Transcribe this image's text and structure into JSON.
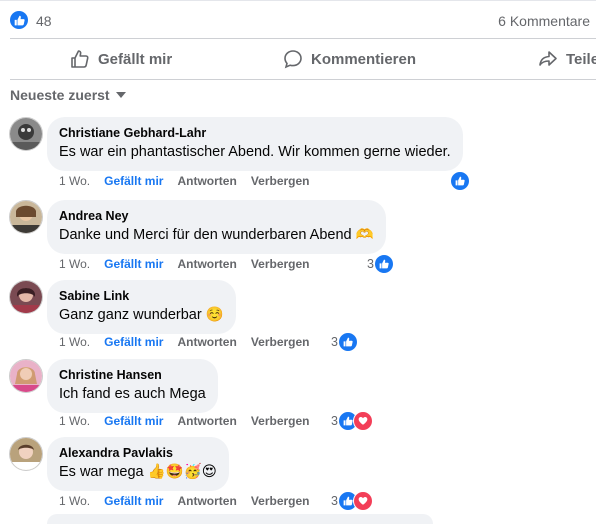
{
  "summary": {
    "like_count": "48",
    "comments_label": "6 Kommentare"
  },
  "actions": {
    "like": "Gefällt mir",
    "comment": "Kommentieren",
    "share": "Teilen"
  },
  "sort_label": "Neueste zuerst",
  "meta_labels": {
    "time": "1 Wo.",
    "like": "Gefällt mir",
    "reply": "Antworten",
    "hide": "Verbergen"
  },
  "colors": {
    "accent": "#1877f2",
    "heart": "#f33e58",
    "bubble": "#f0f2f5",
    "muted": "#65676b"
  },
  "comments": [
    {
      "author": "Christiane Gebhard-Lahr",
      "text": "Es war ein phantastischer Abend. Wir kommen gerne wieder.",
      "reaction_count": "",
      "reactions": [
        "like"
      ]
    },
    {
      "author": "Andrea Ney",
      "text": "Danke und Merci für den wunderbaren Abend 🫶",
      "reaction_count": "3",
      "reactions": [
        "like"
      ]
    },
    {
      "author": "Sabine Link",
      "text": "Ganz ganz wunderbar ☺️",
      "reaction_count": "3",
      "reactions": [
        "like"
      ]
    },
    {
      "author": "Christine Hansen",
      "text": "Ich fand es auch Mega",
      "reaction_count": "3",
      "reactions": [
        "like",
        "heart"
      ]
    },
    {
      "author": "Alexandra Pavlakis",
      "text": "Es war mega 👍🤩🥳😍",
      "reaction_count": "3",
      "reactions": [
        "like",
        "heart"
      ]
    }
  ]
}
